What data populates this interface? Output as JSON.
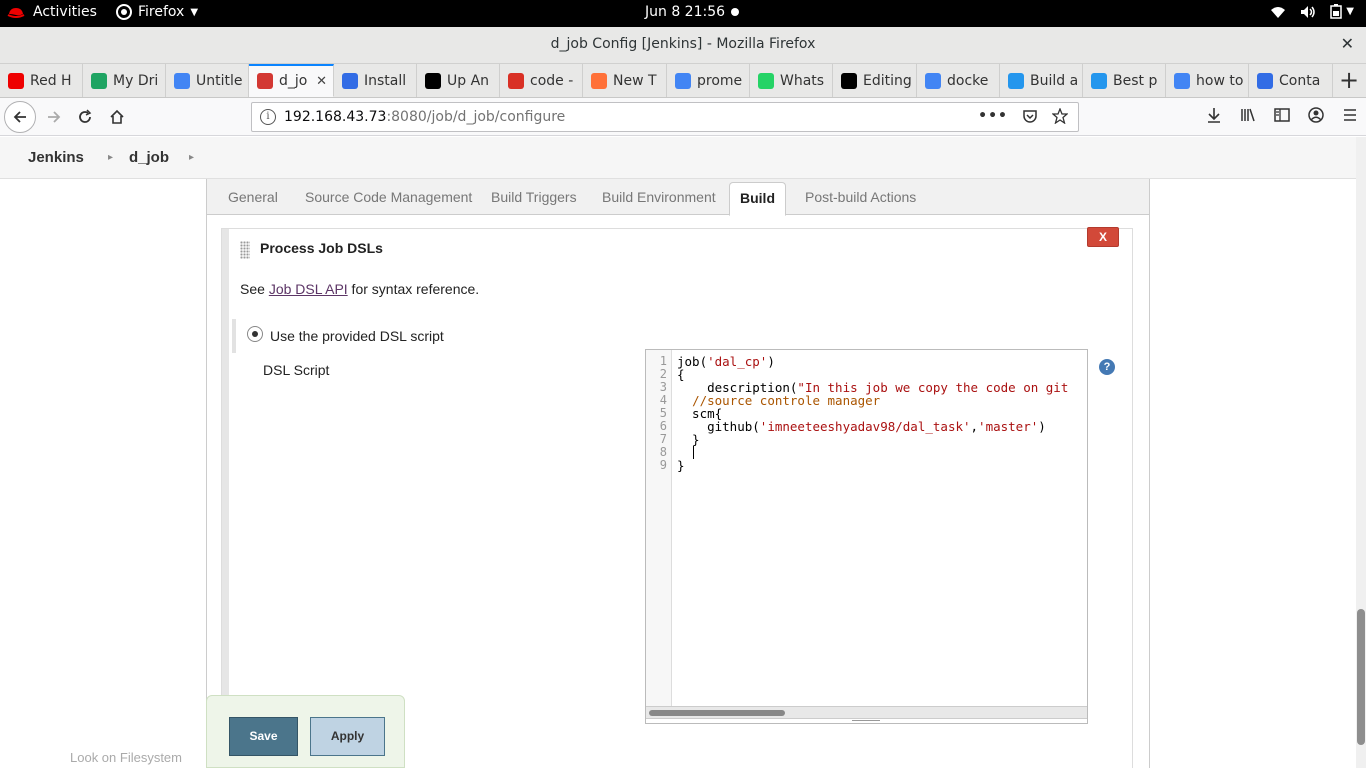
{
  "system_bar": {
    "activities": "Activities",
    "app_name": "Firefox",
    "clock": "Jun 8  21:56"
  },
  "window": {
    "title": "d_job Config [Jenkins] - Mozilla Firefox"
  },
  "tabs": [
    {
      "label": "Red H",
      "icon": "redhat-icon",
      "color": "#e00"
    },
    {
      "label": "My Dri",
      "icon": "drive-icon",
      "color": "#1fa463"
    },
    {
      "label": "Untitle",
      "icon": "docs-icon",
      "color": "#4285f4"
    },
    {
      "label": "d_jo",
      "icon": "jenkins-icon",
      "color": "#d33833",
      "active": true
    },
    {
      "label": "Install",
      "icon": "kubernetes-icon",
      "color": "#326ce5"
    },
    {
      "label": "Up An",
      "icon": "medium-icon",
      "color": "#000"
    },
    {
      "label": "code -",
      "icon": "gmail-icon",
      "color": "#d93025"
    },
    {
      "label": "New T",
      "icon": "firefox-icon",
      "color": "#ff7139"
    },
    {
      "label": "prome",
      "icon": "google-icon",
      "color": "#4285f4"
    },
    {
      "label": "Whats",
      "icon": "whatsapp-icon",
      "color": "#25d366"
    },
    {
      "label": "Editing",
      "icon": "medium-icon",
      "color": "#000"
    },
    {
      "label": "docke",
      "icon": "google-icon",
      "color": "#4285f4"
    },
    {
      "label": "Build a",
      "icon": "docker-icon",
      "color": "#2496ed"
    },
    {
      "label": "Best p",
      "icon": "docker-icon",
      "color": "#2496ed"
    },
    {
      "label": "how to",
      "icon": "google-icon",
      "color": "#4285f4"
    },
    {
      "label": "Conta",
      "icon": "kubernetes-icon",
      "color": "#326ce5"
    }
  ],
  "address": {
    "host": "192.168.43.73",
    "path": ":8080/job/d_job/configure"
  },
  "breadcrumbs": [
    "Jenkins",
    "d_job"
  ],
  "config_tabs": [
    "General",
    "Source Code Management",
    "Build Triggers",
    "Build Environment",
    "Build",
    "Post-build Actions"
  ],
  "builder": {
    "title": "Process Job DSLs",
    "delete_label": "X",
    "see_prefix": "See ",
    "see_link": "Job DSL API",
    "see_suffix": " for syntax reference.",
    "radio_label": "Use the provided DSL script",
    "dsl_label": "DSL Script",
    "help": "?"
  },
  "editor": {
    "line_numbers": [
      "1",
      "2",
      "3",
      "4",
      "5",
      "6",
      "7",
      "8",
      "9"
    ]
  },
  "buttons": {
    "save": "Save",
    "apply": "Apply"
  },
  "hidden_option": "Look on Filesystem"
}
